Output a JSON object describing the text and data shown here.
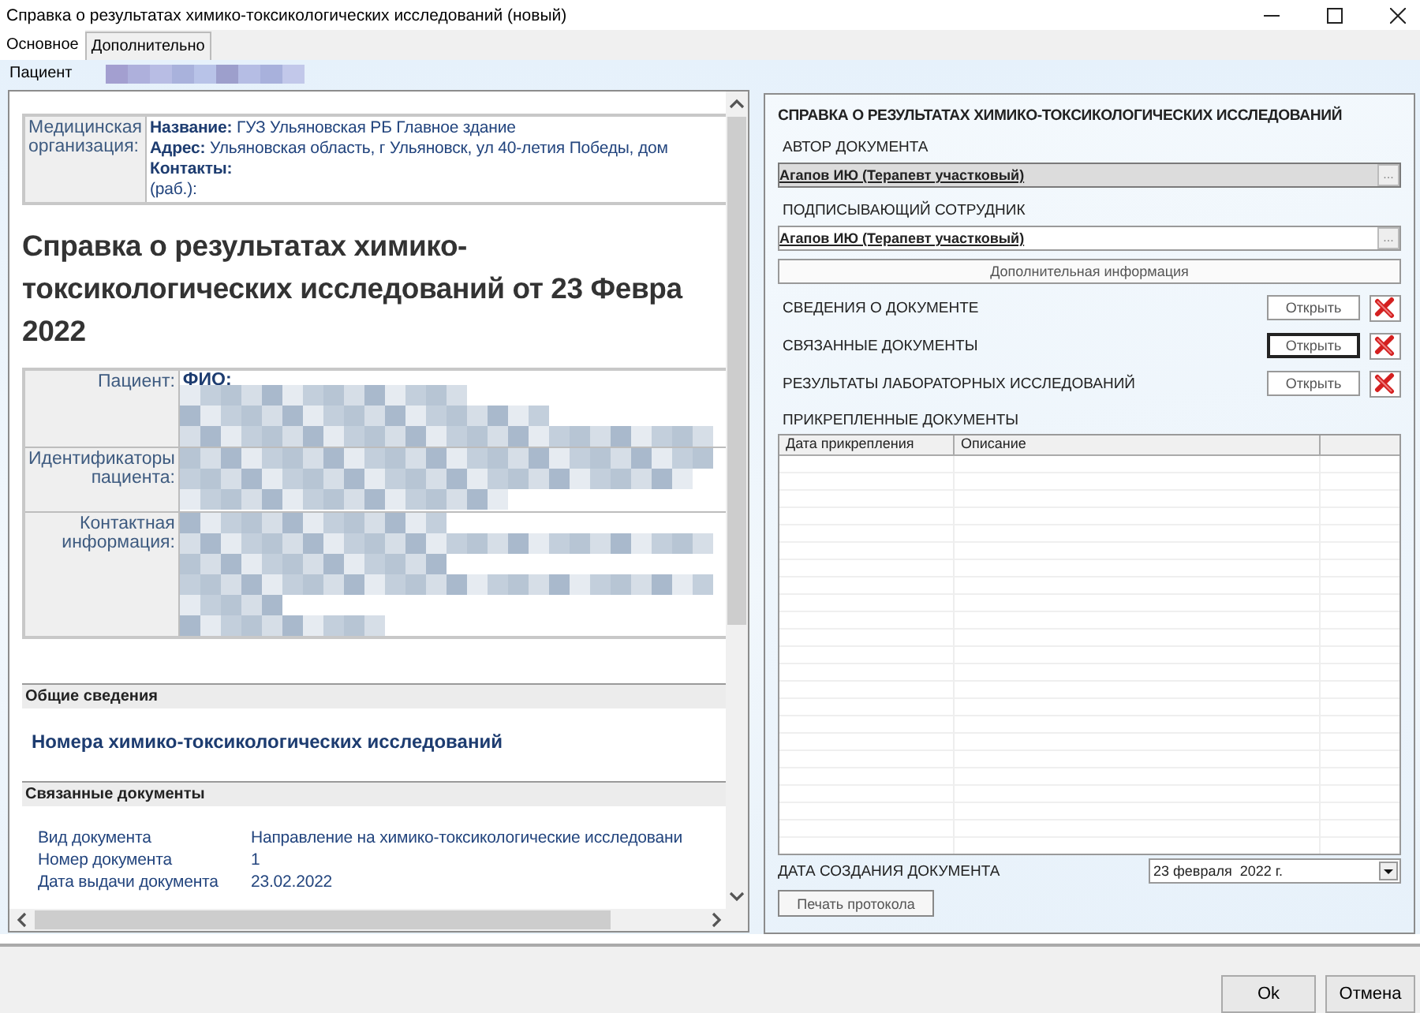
{
  "window": {
    "title": "Справка о результатах химико-токсикологических исследований (новый)"
  },
  "tabs": [
    {
      "label": "Основное",
      "selected": true
    },
    {
      "label": "Дополнительно",
      "selected": false
    }
  ],
  "patient_bar": {
    "label": "Пациент"
  },
  "document": {
    "org": {
      "label": "Медицинская организация:",
      "fields": [
        {
          "label": "Название:",
          "value": "ГУЗ Ульяновская РБ Главное здание"
        },
        {
          "label": "Адрес:",
          "value": "Ульяновская область, г Ульяновск, ул 40-летия Победы, дом"
        },
        {
          "label": "Контакты:"
        },
        {
          "value": "(раб.):"
        }
      ]
    },
    "heading_lines": [
      "Справка о результатах химико-",
      "токсикологических исследований от 23 Февра",
      "2022"
    ],
    "patient_rows": [
      {
        "label": "Пациент:",
        "field": "ФИО:"
      },
      {
        "label": "Идентификаторы пациента:"
      },
      {
        "label": "Контактная информация:"
      }
    ],
    "general": {
      "title": "Общие сведения",
      "subtitle": "Номера химико-токсикологических исследований"
    },
    "related": {
      "title": "Связанные документы",
      "rows": [
        {
          "label": "Вид документа",
          "value": "Направление на химико-токсикологические исследовани"
        },
        {
          "label": "Номер документа",
          "value": "1"
        },
        {
          "label": "Дата выдачи документа",
          "value": "23.02.2022"
        }
      ]
    }
  },
  "right_panel": {
    "title": "СПРАВКА О РЕЗУЛЬТАТАХ ХИМИКО-ТОКСИКОЛОГИЧЕСКИХ ИССЛЕДОВАНИЙ",
    "pickers": [
      {
        "label": "АВТОР ДОКУМЕНТА",
        "value": "Агапов ИЮ (Терапевт участковый)",
        "disabled": true,
        "button": "..."
      },
      {
        "label": "ПОДПИСЫВАЮЩИЙ СОТРУДНИК",
        "value": "Агапов ИЮ (Терапевт участковый)",
        "disabled": false,
        "button": "..."
      }
    ],
    "extra_button": "Дополнительная информация",
    "sections": [
      {
        "label": "СВЕДЕНИЯ О ДОКУМЕНТЕ",
        "button": "Открыть",
        "focused": false
      },
      {
        "label": "СВЯЗАННЫЕ ДОКУМЕНТЫ",
        "button": "Открыть",
        "focused": true
      },
      {
        "label": "РЕЗУЛЬТАТЫ ЛАБОРАТОРНЫХ ИССЛЕДОВАНИЙ",
        "button": "Открыть",
        "focused": false
      }
    ],
    "attached": {
      "label": "ПРИКРЕПЛЕННЫЕ ДОКУМЕНТЫ",
      "columns": [
        "Дата прикрепления",
        "Описание"
      ]
    },
    "created": {
      "label": "ДАТА СОЗДАНИЯ ДОКУМЕНТА",
      "value": "23 февраля  2022 г."
    },
    "print_button": "Печать протокола"
  },
  "footer": {
    "buttons": [
      "Ok",
      "Отмена"
    ]
  }
}
